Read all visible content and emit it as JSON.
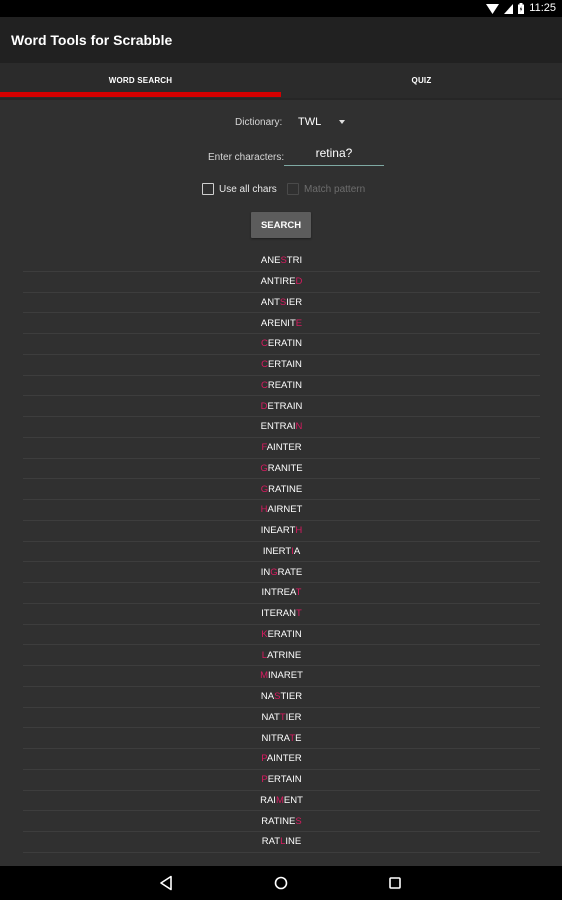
{
  "status_bar": {
    "time": "11:25",
    "icons": [
      "wifi-icon",
      "signal-icon",
      "battery-charging-icon"
    ]
  },
  "app_bar": {
    "title": "Word Tools for Scrabble"
  },
  "tabs": [
    {
      "label": "WORD SEARCH",
      "selected": true
    },
    {
      "label": "QUIZ",
      "selected": false
    }
  ],
  "colors": {
    "tab_indicator": "#d40000",
    "highlight_letter": "#d81b60",
    "input_underline": "#7fa9a3"
  },
  "form": {
    "dictionary_label": "Dictionary:",
    "dictionary_value": "TWL",
    "chars_label": "Enter characters:",
    "chars_value": "retina?",
    "use_all_chars_label": "Use all chars",
    "use_all_chars_checked": false,
    "match_pattern_label": "Match pattern",
    "match_pattern_checked": false,
    "match_pattern_enabled": false,
    "search_label": "SEARCH"
  },
  "results": [
    {
      "pre": "ANE",
      "hl": "S",
      "post": "TRI"
    },
    {
      "pre": "ANTIRE",
      "hl": "D",
      "post": ""
    },
    {
      "pre": "ANT",
      "hl": "S",
      "post": "IER"
    },
    {
      "pre": "ARENIT",
      "hl": "E",
      "post": ""
    },
    {
      "pre": "",
      "hl": "C",
      "post": "ERATIN"
    },
    {
      "pre": "",
      "hl": "C",
      "post": "ERTAIN"
    },
    {
      "pre": "",
      "hl": "C",
      "post": "REATIN"
    },
    {
      "pre": "",
      "hl": "D",
      "post": "ETRAIN"
    },
    {
      "pre": "ENTRAI",
      "hl": "N",
      "post": ""
    },
    {
      "pre": "",
      "hl": "F",
      "post": "AINTER"
    },
    {
      "pre": "",
      "hl": "G",
      "post": "RANITE"
    },
    {
      "pre": "",
      "hl": "G",
      "post": "RATINE"
    },
    {
      "pre": "",
      "hl": "H",
      "post": "AIRNET"
    },
    {
      "pre": "INEART",
      "hl": "H",
      "post": ""
    },
    {
      "pre": "INERT",
      "hl": "I",
      "post": "A"
    },
    {
      "pre": "IN",
      "hl": "G",
      "post": "RATE"
    },
    {
      "pre": "INTREA",
      "hl": "T",
      "post": ""
    },
    {
      "pre": "ITERAN",
      "hl": "T",
      "post": ""
    },
    {
      "pre": "",
      "hl": "K",
      "post": "ERATIN"
    },
    {
      "pre": "",
      "hl": "L",
      "post": "ATRINE"
    },
    {
      "pre": "",
      "hl": "M",
      "post": "INARET"
    },
    {
      "pre": "NA",
      "hl": "S",
      "post": "TIER"
    },
    {
      "pre": "NAT",
      "hl": "T",
      "post": "IER"
    },
    {
      "pre": "NITRA",
      "hl": "T",
      "post": "E"
    },
    {
      "pre": "",
      "hl": "P",
      "post": "AINTER"
    },
    {
      "pre": "",
      "hl": "P",
      "post": "ERTAIN"
    },
    {
      "pre": "RAI",
      "hl": "M",
      "post": "ENT"
    },
    {
      "pre": "RATINE",
      "hl": "S",
      "post": ""
    },
    {
      "pre": "RAT",
      "hl": "L",
      "post": "INE"
    }
  ],
  "nav_bar": {
    "buttons": [
      "back-icon",
      "home-icon",
      "recents-icon"
    ]
  }
}
